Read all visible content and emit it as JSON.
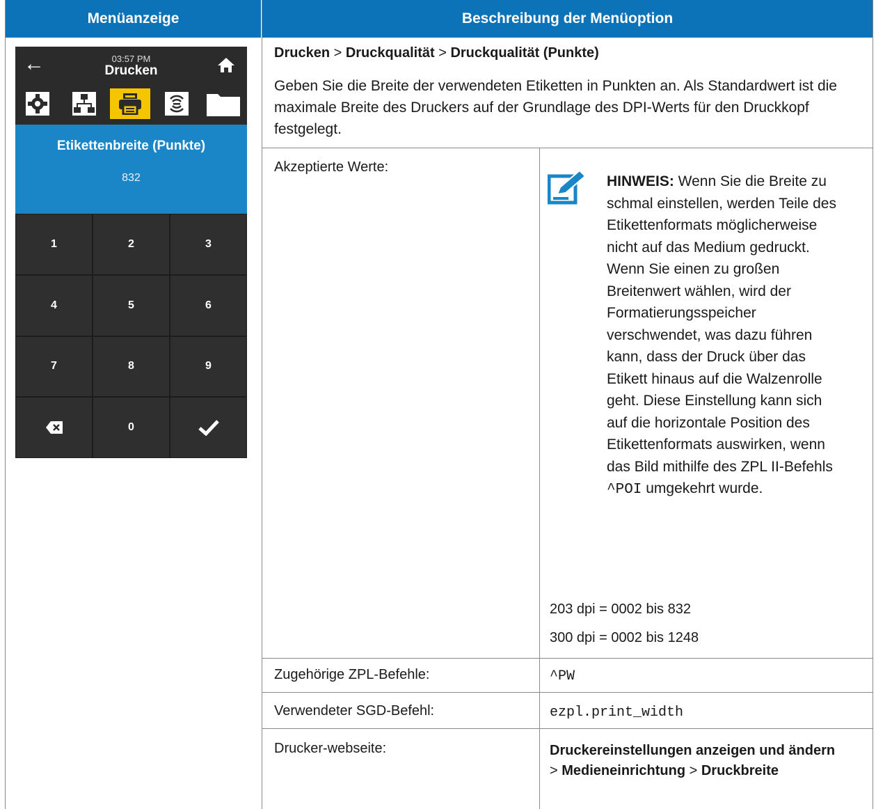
{
  "header": {
    "left": "Menüanzeige",
    "right": "Beschreibung der Menüoption"
  },
  "device": {
    "time": "03:57 PM",
    "title": "Drucken",
    "field_label": "Etikettenbreite (Punkte)",
    "field_value": "832",
    "tabs": [
      {
        "icon": "gear-icon",
        "active": false
      },
      {
        "icon": "network-icon",
        "active": false
      },
      {
        "icon": "printer-icon",
        "active": true
      },
      {
        "icon": "wireless-icon",
        "active": false
      },
      {
        "icon": "folder-icon",
        "active": false
      }
    ],
    "keys": [
      "1",
      "2",
      "3",
      "4",
      "5",
      "6",
      "7",
      "8",
      "9",
      "⌫",
      "0",
      "✓"
    ]
  },
  "content": {
    "breadcrumb": {
      "part1": "Drucken",
      "sep1": " > ",
      "part2": "Druckqualität",
      "sep2": " > ",
      "part3": "Druckqualität (Punkte)"
    },
    "description": "Geben Sie die Breite der verwendeten Etiketten in Punkten an. Als Standardwert ist die maximale Breite des Druckers auf der Grundlage des DPI-Werts für den Druckkopf festgelegt.",
    "accepted_label": "Akzeptierte Werte:",
    "note_title": "HINWEIS:",
    "note_text_1": " Wenn Sie die Breite zu schmal einstellen, werden Teile des Etikettenformats möglicherweise nicht auf das Medium gedruckt. Wenn Sie einen zu großen Breitenwert wählen, wird der Formatierungsspeicher verschwendet, was dazu führen kann, dass der Druck über das Etikett hinaus auf die Walzenrolle geht. Diese Einstellung kann sich auf die horizontale Position des Etikettenformats auswirken, wenn das Bild mithilfe des ZPL II-Befehls ",
    "note_code": "^POI",
    "note_text_2": " umgekehrt wurde.",
    "value_203": "203 dpi = 0002 bis 832",
    "value_300": "300 dpi = 0002 bis 1248",
    "zpl_label": "Zugehörige ZPL-Befehle:",
    "zpl_value": "^PW",
    "sgd_label": "Verwendeter SGD-Befehl:",
    "sgd_value": "ezpl.print_width",
    "web_label": "Drucker-webseite:",
    "web_part1": "Druckereinstellungen anzeigen und ändern",
    "web_sep1": " > ",
    "web_part2": "Medieneinrichtung",
    "web_sep2": " > ",
    "web_part3": "Druckbreite"
  }
}
